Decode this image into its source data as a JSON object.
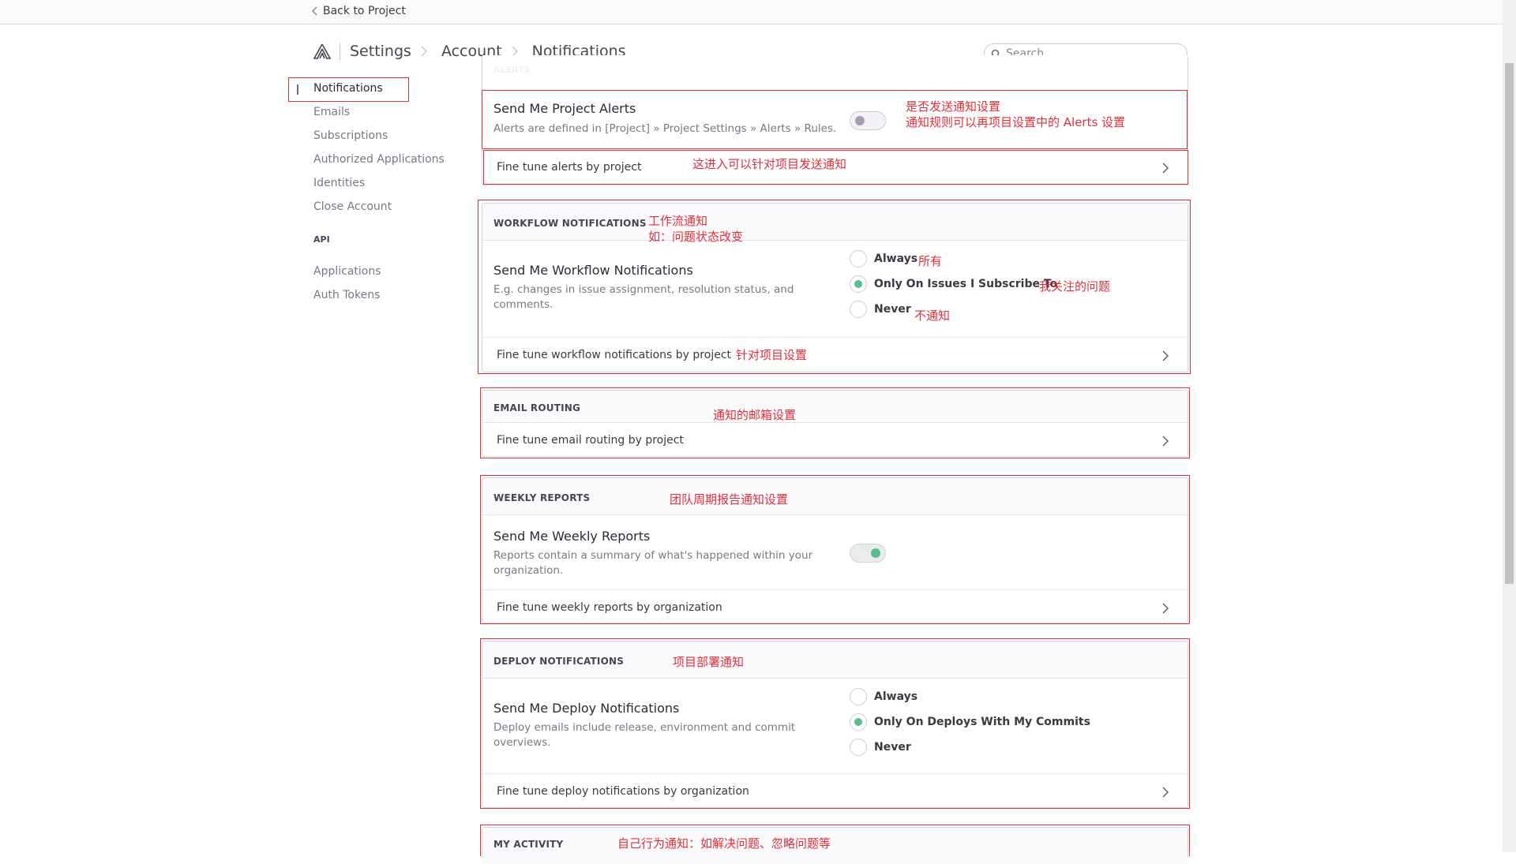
{
  "topbar": {
    "back_label": "Back to Project"
  },
  "breadcrumb": {
    "items": [
      "Settings",
      "Account",
      "Notifications"
    ]
  },
  "search": {
    "placeholder": "Search"
  },
  "sidebar": {
    "items": [
      "Notifications",
      "Emails",
      "Subscriptions",
      "Authorized Applications",
      "Identities",
      "Close Account"
    ],
    "api_heading": "API",
    "api_items": [
      "Applications",
      "Auth Tokens"
    ]
  },
  "alerts": {
    "heading": "ALERTS",
    "title": "Send Me Project Alerts",
    "desc": "Alerts are defined in [Project] » Project Settings » Alerts » Rules.",
    "toggle_on": false,
    "link": "Fine tune alerts by project",
    "note1": "是否发送通知设置",
    "note2": "通知规则可以再项目设置中的 Alerts 设置",
    "note_link": "这进入可以针对项目发送通知"
  },
  "workflow": {
    "heading": "WORKFLOW NOTIFICATIONS",
    "title": "Send Me Workflow Notifications",
    "desc": "E.g. changes in issue assignment, resolution status, and comments.",
    "options": [
      "Always",
      "Only On Issues I Subscribe To",
      "Never"
    ],
    "selected": "Only On Issues I Subscribe To",
    "link": "Fine tune workflow notifications by project",
    "note_head1": "工作流通知",
    "note_head2": "如：问题状态改变",
    "note_always": "所有",
    "note_subscribe": "我关注的问题",
    "note_never": "不通知",
    "note_link": "针对项目设置"
  },
  "email_routing": {
    "heading": "EMAIL ROUTING",
    "link": "Fine tune email routing by project",
    "note": "通知的邮箱设置"
  },
  "weekly": {
    "heading": "WEEKLY REPORTS",
    "title": "Send Me Weekly Reports",
    "desc": "Reports contain a summary of what's happened within your organization.",
    "toggle_on": true,
    "link": "Fine tune weekly reports by organization",
    "note": "团队周期报告通知设置"
  },
  "deploy": {
    "heading": "DEPLOY NOTIFICATIONS",
    "title": "Send Me Deploy Notifications",
    "desc": "Deploy emails include release, environment and commit overviews.",
    "options": [
      "Always",
      "Only On Deploys With My Commits",
      "Never"
    ],
    "selected": "Only On Deploys With My Commits",
    "link": "Fine tune deploy notifications by organization",
    "note": "项目部署通知"
  },
  "activity": {
    "heading": "MY ACTIVITY",
    "note": "自己行为通知：如解决问题、忽略问题等"
  },
  "colors": {
    "annotation_red": "#e0303a",
    "accent_green": "#57be8c",
    "accent_purple": "#6c5fc7"
  }
}
